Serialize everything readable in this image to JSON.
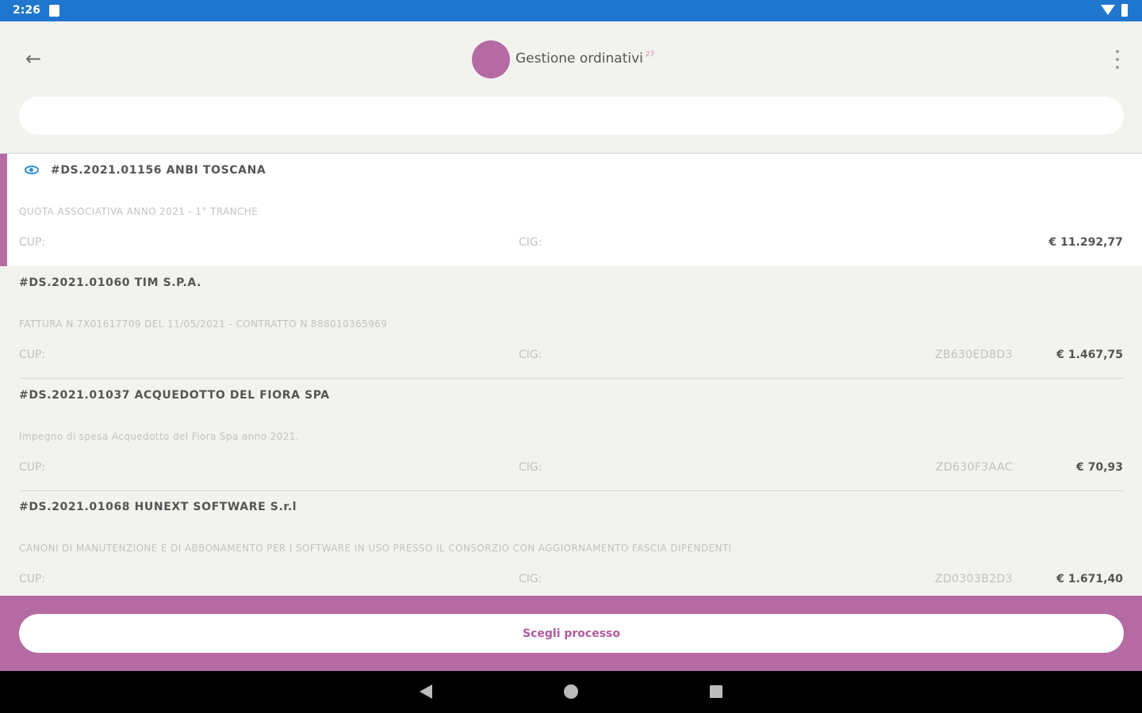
{
  "status_bar": {
    "time": "2:26",
    "icons": [
      "sd-card-icon",
      "wifi-icon",
      "battery-icon"
    ]
  },
  "header": {
    "back_icon": "arrow-left-icon",
    "back_glyph": "←",
    "title": "Gestione ordinativi",
    "badge": "27",
    "more_icon": "more-vertical-icon",
    "avatar_color": "#b56aa4"
  },
  "search": {
    "value": "",
    "placeholder": ""
  },
  "orders": [
    {
      "title": "#DS.2021.01156 ANBI TOSCANA",
      "description": "QUOTA ASSOCIATIVA ANNO 2021 - 1° TRANCHE",
      "cup_label": "CUP:",
      "cig_label": "CIG:",
      "cig_value": "",
      "amount": "€ 11.292,77",
      "selected": true,
      "icon": "eye-icon"
    },
    {
      "title": "#DS.2021.01060 TIM S.P.A.",
      "description": "FATTURA N 7X01617709 DEL 11/05/2021 - CONTRATTO N 888010365969",
      "cup_label": "CUP:",
      "cig_label": "CIG:",
      "cig_value": "ZB630ED8D3",
      "amount": "€ 1.467,75"
    },
    {
      "title": "#DS.2021.01037 ACQUEDOTTO DEL FIORA SPA",
      "description": "Impegno di spesa Acquedotto del Fiora Spa anno 2021.",
      "cup_label": "CUP:",
      "cig_label": "CIG:",
      "cig_value": "ZD630F3AAC",
      "amount": "€ 70,93"
    },
    {
      "title": "#DS.2021.01068 HUNEXT SOFTWARE  S.r.l",
      "description": "CANONI DI MANUTENZIONE E DI ABBONAMENTO PER I SOFTWARE IN USO PRESSO IL CONSORZIO  CON AGGIORNAMENTO FASCIA DIPENDENTI",
      "cup_label": "CUP:",
      "cig_label": "CIG:",
      "cig_value": "ZD0303B2D3",
      "amount": "€ 1.671,40"
    }
  ],
  "footer": {
    "button_label": "Scegli processo"
  },
  "nav_bar": {
    "icons": [
      "nav-back-icon",
      "nav-home-icon",
      "nav-recents-icon"
    ]
  },
  "colors": {
    "status_bar": "#1e76cf",
    "accent": "#b56aa4",
    "accent_text": "#b05a9e",
    "eye_icon": "#2a8ed8",
    "background": "#f2f2ef"
  }
}
